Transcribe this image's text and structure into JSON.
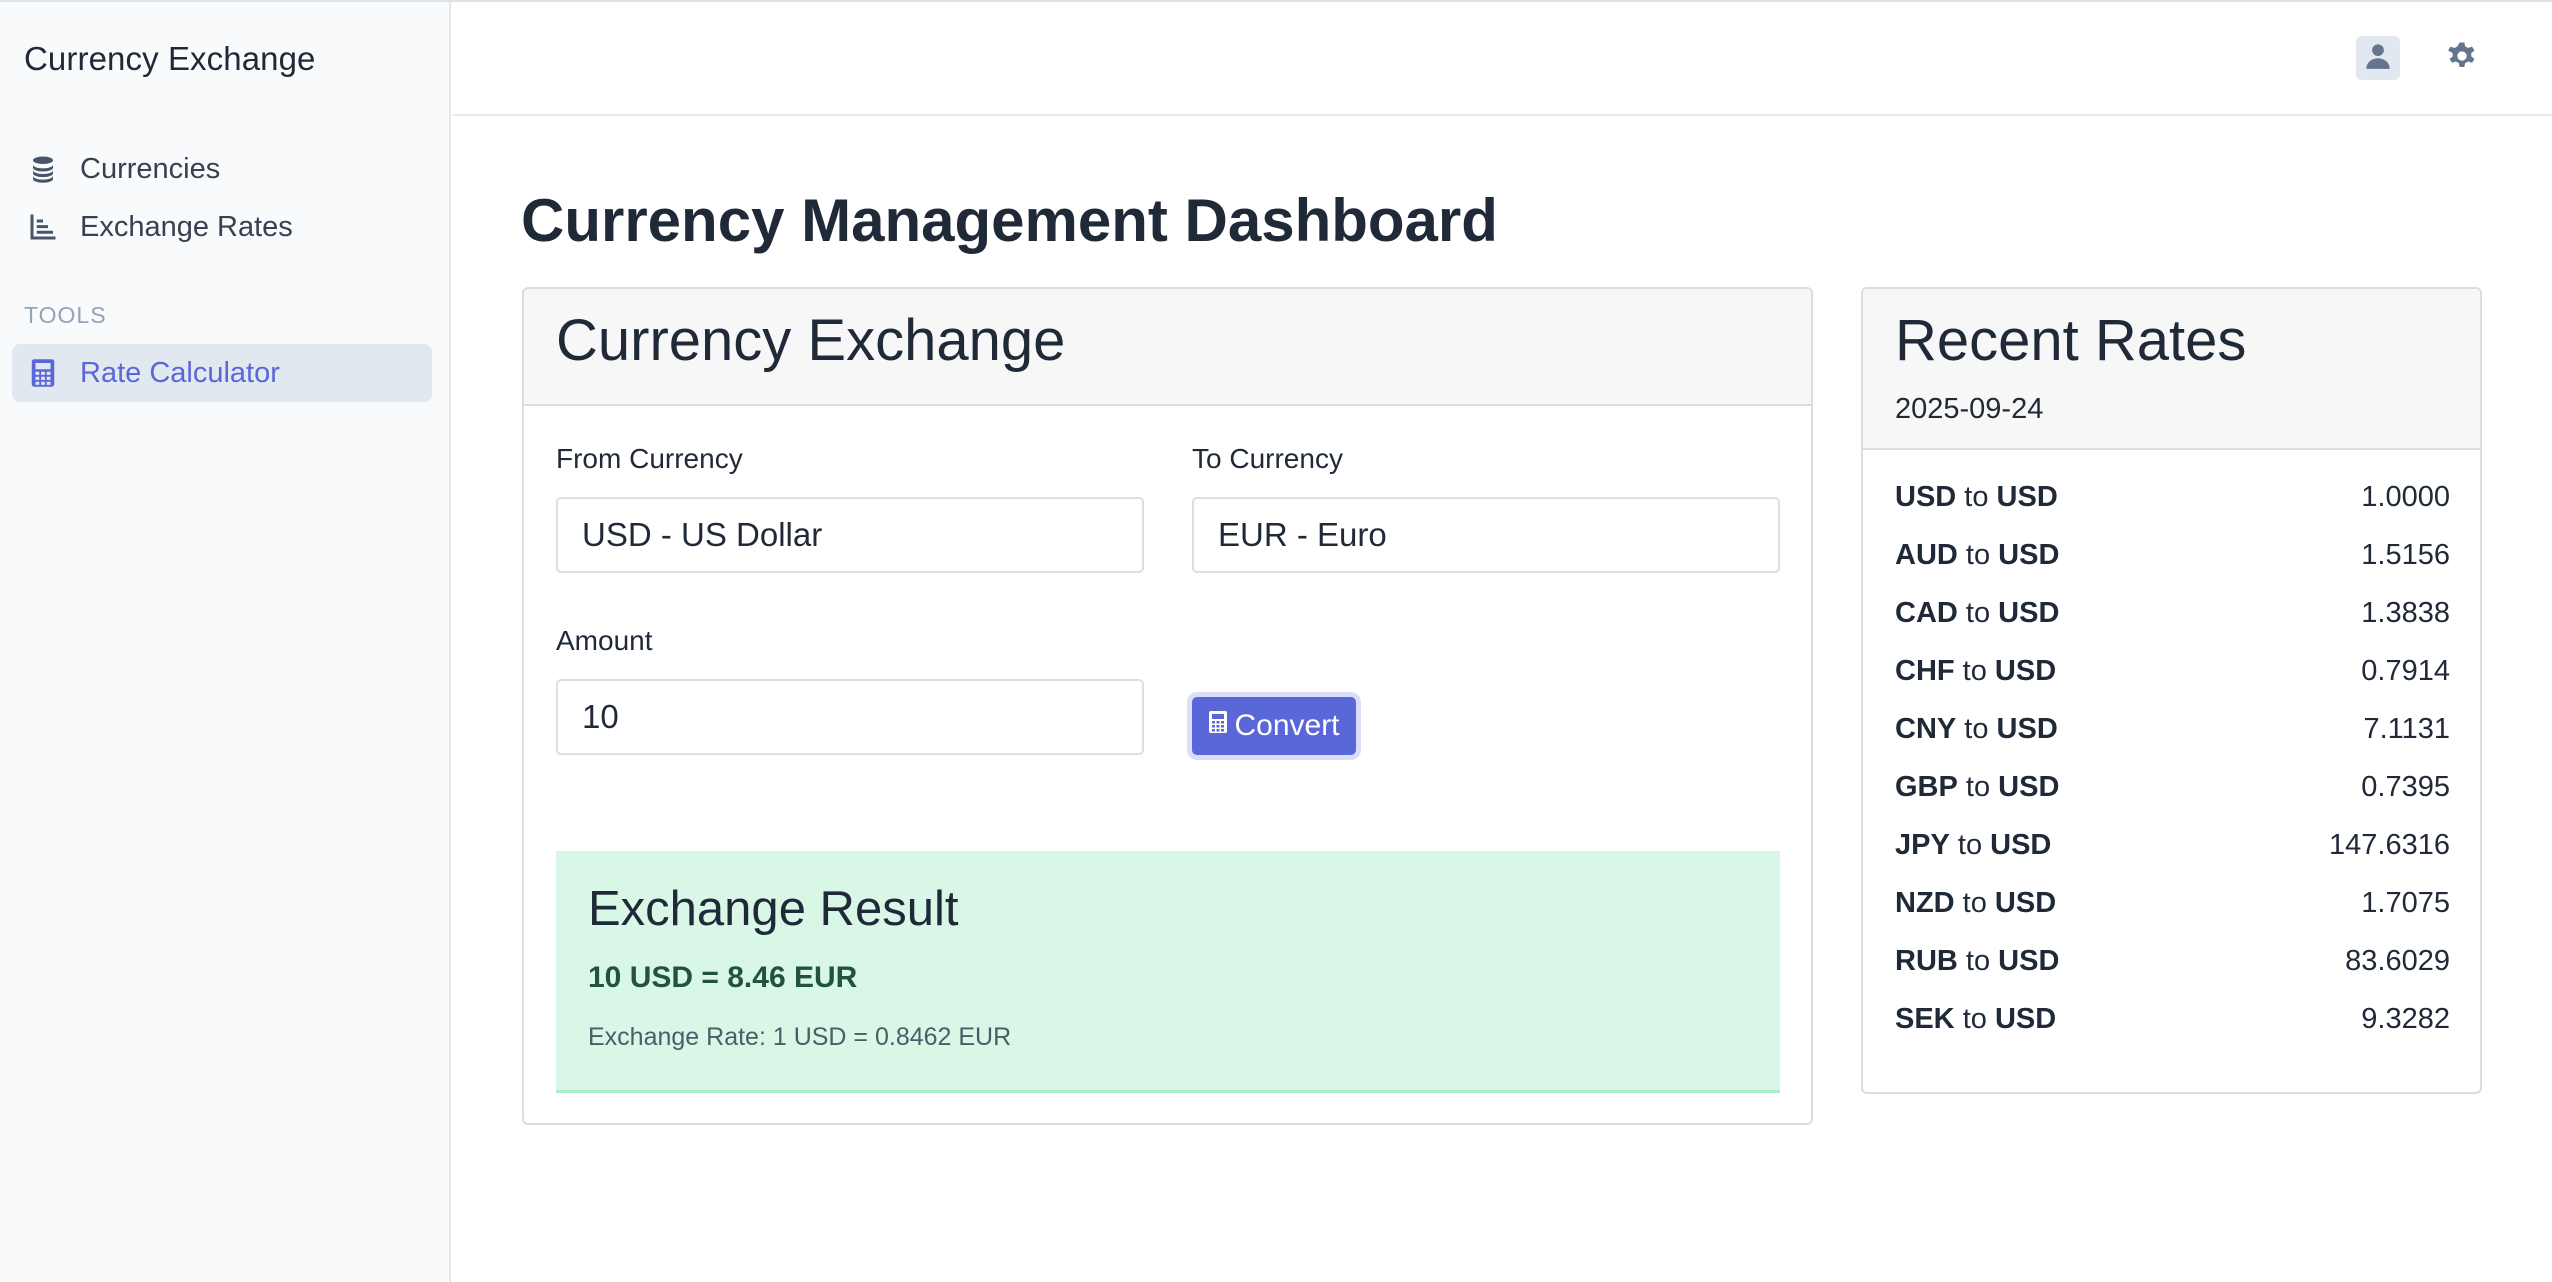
{
  "sidebar": {
    "brand": "Currency Exchange",
    "items": [
      {
        "label": "Currencies",
        "icon": "coins-icon"
      },
      {
        "label": "Exchange Rates",
        "icon": "bar-chart-icon"
      }
    ],
    "section_label": "TOOLS",
    "tools": [
      {
        "label": "Rate Calculator",
        "icon": "calculator-icon",
        "active": true
      }
    ]
  },
  "header": {
    "icons": [
      "user-icon",
      "gear-icon"
    ]
  },
  "main": {
    "title": "Currency Management Dashboard",
    "exchange": {
      "title": "Currency Exchange",
      "from_label": "From Currency",
      "from_value": "USD - US Dollar",
      "to_label": "To Currency",
      "to_value": "EUR - Euro",
      "amount_label": "Amount",
      "amount_value": "10",
      "convert_label": "Convert",
      "result": {
        "title": "Exchange Result",
        "main": "10 USD = 8.46 EUR",
        "rate": "Exchange Rate: 1 USD = 0.8462 EUR"
      }
    },
    "recent_rates": {
      "title": "Recent Rates",
      "date": "2025-09-24",
      "connector": "to",
      "rows": [
        {
          "from": "USD",
          "to": "USD",
          "value": "1.0000"
        },
        {
          "from": "AUD",
          "to": "USD",
          "value": "1.5156"
        },
        {
          "from": "CAD",
          "to": "USD",
          "value": "1.3838"
        },
        {
          "from": "CHF",
          "to": "USD",
          "value": "0.7914"
        },
        {
          "from": "CNY",
          "to": "USD",
          "value": "7.1131"
        },
        {
          "from": "GBP",
          "to": "USD",
          "value": "0.7395"
        },
        {
          "from": "JPY",
          "to": "USD",
          "value": "147.6316"
        },
        {
          "from": "NZD",
          "to": "USD",
          "value": "1.7075"
        },
        {
          "from": "RUB",
          "to": "USD",
          "value": "83.6029"
        },
        {
          "from": "SEK",
          "to": "USD",
          "value": "9.3282"
        }
      ]
    }
  },
  "colors": {
    "accent": "#5a67d8",
    "result_bg": "#d9f7e6",
    "result_text": "#22543d"
  }
}
